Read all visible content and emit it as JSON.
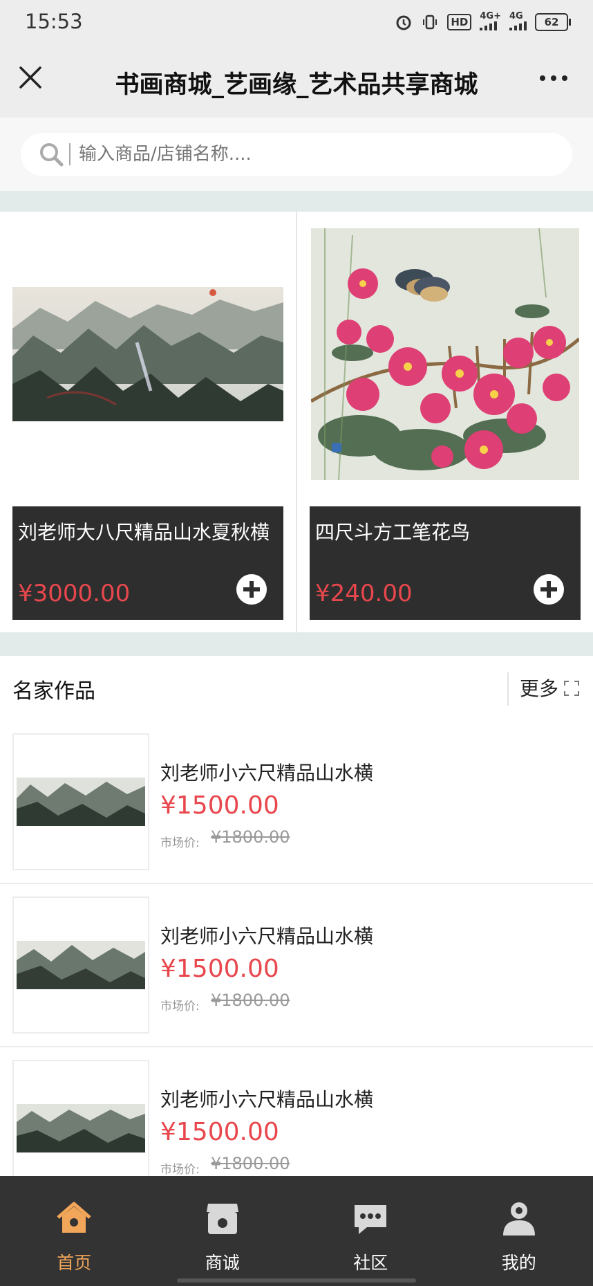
{
  "status_bar": {
    "time": "15:53",
    "network_1": "4G+",
    "network_2": "4G",
    "hd_label": "HD",
    "battery": "62"
  },
  "titlebar": {
    "title": "书画商城_艺画缘_艺术品共享商城"
  },
  "search": {
    "placeholder": "输入商品/店铺名称...."
  },
  "featured": [
    {
      "name": "刘老师大八尺精品山水夏秋横",
      "price": "¥3000.00",
      "image": "landscape-painting"
    },
    {
      "name": "四尺斗方工笔花鸟",
      "price": "¥240.00",
      "image": "flower-bird-painting"
    }
  ],
  "section": {
    "title": "名家作品",
    "more": "更多"
  },
  "list": [
    {
      "name": "刘老师小六尺精品山水横",
      "price": "¥1500.00",
      "market_label": "市场价:",
      "market_price": "¥1800.00"
    },
    {
      "name": "刘老师小六尺精品山水横",
      "price": "¥1500.00",
      "market_label": "市场价:",
      "market_price": "¥1800.00"
    },
    {
      "name": "刘老师小六尺精品山水横",
      "price": "¥1500.00",
      "market_label": "市场价:",
      "market_price": "¥1800.00"
    }
  ],
  "tabs": [
    {
      "label": "首页",
      "icon": "home-icon",
      "active": true
    },
    {
      "label": "商诚",
      "icon": "shop-icon",
      "active": false
    },
    {
      "label": "社区",
      "icon": "chat-icon",
      "active": false
    },
    {
      "label": "我的",
      "icon": "user-icon",
      "active": false
    }
  ],
  "colors": {
    "accent": "#f2a65a",
    "price": "#e8474d",
    "tabbar": "#333333",
    "card_info": "#2e2e2e"
  }
}
